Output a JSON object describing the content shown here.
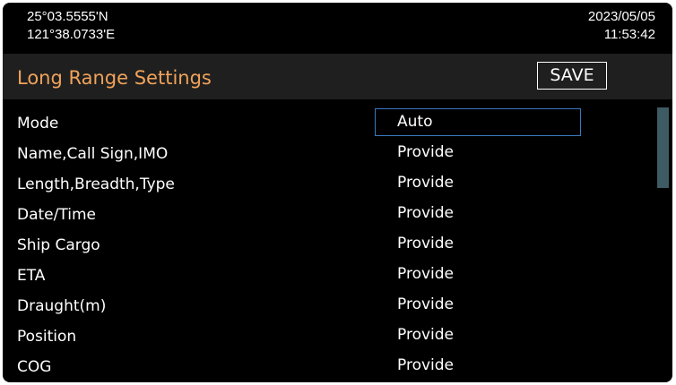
{
  "header": {
    "latitude": "25°03.5555'N",
    "longitude": "121°38.0733'E",
    "date": "2023/05/05",
    "time": "11:53:42"
  },
  "title_bar": {
    "title": "Long Range Settings",
    "save_label": "SAVE"
  },
  "settings": [
    {
      "label": "Mode",
      "value": "Auto"
    },
    {
      "label": "Name,Call Sign,IMO",
      "value": "Provide"
    },
    {
      "label": "Length,Breadth,Type",
      "value": "Provide"
    },
    {
      "label": "Date/Time",
      "value": "Provide"
    },
    {
      "label": "Ship Cargo",
      "value": "Provide"
    },
    {
      "label": "ETA",
      "value": "Provide"
    },
    {
      "label": "Draught(m)",
      "value": "Provide"
    },
    {
      "label": "Position",
      "value": "Provide"
    },
    {
      "label": "COG",
      "value": "Provide"
    }
  ],
  "colors": {
    "background": "#000000",
    "title_text": "#f0a35a",
    "title_bar": "#1f1f1f",
    "selection_border": "#3a78c2",
    "scrollbar": "#3e5a62"
  }
}
